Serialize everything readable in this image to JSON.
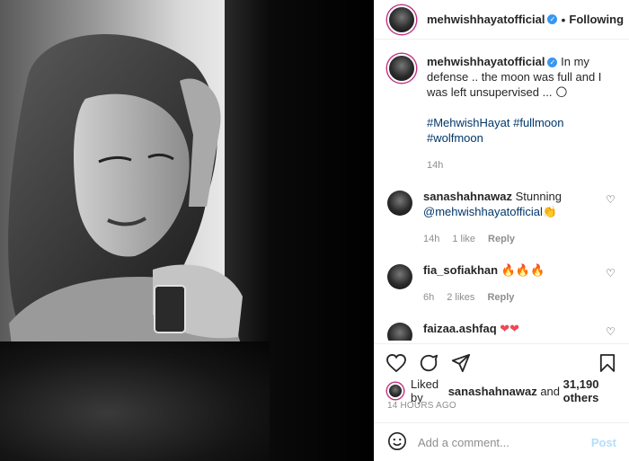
{
  "header": {
    "username": "mehwishhayatofficial",
    "separator": "•",
    "following_label": "Following"
  },
  "caption": {
    "username": "mehwishhayatofficial",
    "text": "In my defense .. the moon was full and I was left unsupervised ... 🌕",
    "hashtags": "#MehwishHayat #fullmoon #wolfmoon",
    "time": "14h"
  },
  "comments": [
    {
      "username": "sanashahnawaz",
      "text": "Stunning",
      "mention": "@mehwishhayatofficial",
      "emoji": "👏",
      "time": "14h",
      "likes": "1 like",
      "reply_label": "Reply"
    },
    {
      "username": "fia_sofiakhan",
      "text": "",
      "mention": "",
      "emoji": "🔥🔥🔥",
      "time": "6h",
      "likes": "2 likes",
      "reply_label": "Reply"
    },
    {
      "username": "faizaa.ashfaq",
      "text": "",
      "mention": "",
      "emoji": "❤❤",
      "time": "",
      "likes": "",
      "reply_label": ""
    }
  ],
  "likes_summary": {
    "prefix": "Liked by",
    "user": "sanashahnawaz",
    "middle": "and",
    "count": "31,190 others"
  },
  "post_time": "14 HOURS AGO",
  "comment_box": {
    "placeholder": "Add a comment...",
    "post_label": "Post"
  },
  "colors": {
    "link": "#00376b",
    "verified": "#3897f0",
    "muted": "#8e8e8e",
    "post_disabled": "#b2dffc",
    "fire": "#f56040",
    "heart_red": "#ed4956"
  },
  "icons": [
    "heart-icon",
    "comment-icon",
    "share-icon",
    "bookmark-icon",
    "emoji-icon",
    "verified-badge-icon"
  ]
}
